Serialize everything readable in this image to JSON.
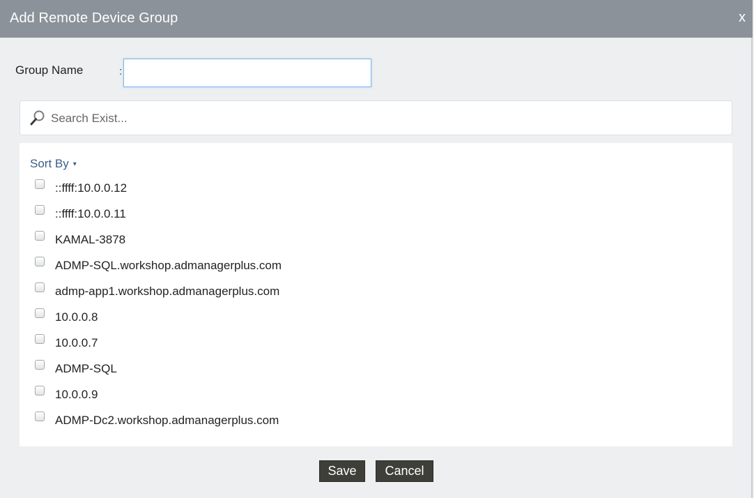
{
  "dialog": {
    "title": "Add Remote Device Group",
    "close_label": "x"
  },
  "form": {
    "group_name_label": "Group Name",
    "colon": ":",
    "group_name_value": ""
  },
  "search": {
    "placeholder": "Search Exist...",
    "icon": "search-icon"
  },
  "list": {
    "sort_by_label": "Sort By",
    "sort_caret": "▾",
    "items": [
      {
        "label": "::ffff:10.0.0.12",
        "checked": false
      },
      {
        "label": "::ffff:10.0.0.11",
        "checked": false
      },
      {
        "label": "KAMAL-3878",
        "checked": false
      },
      {
        "label": "ADMP-SQL.workshop.admanagerplus.com",
        "checked": false
      },
      {
        "label": "admp-app1.workshop.admanagerplus.com",
        "checked": false
      },
      {
        "label": "10.0.0.8",
        "checked": false
      },
      {
        "label": "10.0.0.7",
        "checked": false
      },
      {
        "label": "ADMP-SQL",
        "checked": false
      },
      {
        "label": "10.0.0.9",
        "checked": false
      },
      {
        "label": "ADMP-Dc2.workshop.admanagerplus.com",
        "checked": false
      }
    ]
  },
  "buttons": {
    "save_label": "Save",
    "cancel_label": "Cancel"
  },
  "colors": {
    "titlebar": "#8b9299",
    "button": "#3d3f38",
    "link": "#3a5f88"
  }
}
